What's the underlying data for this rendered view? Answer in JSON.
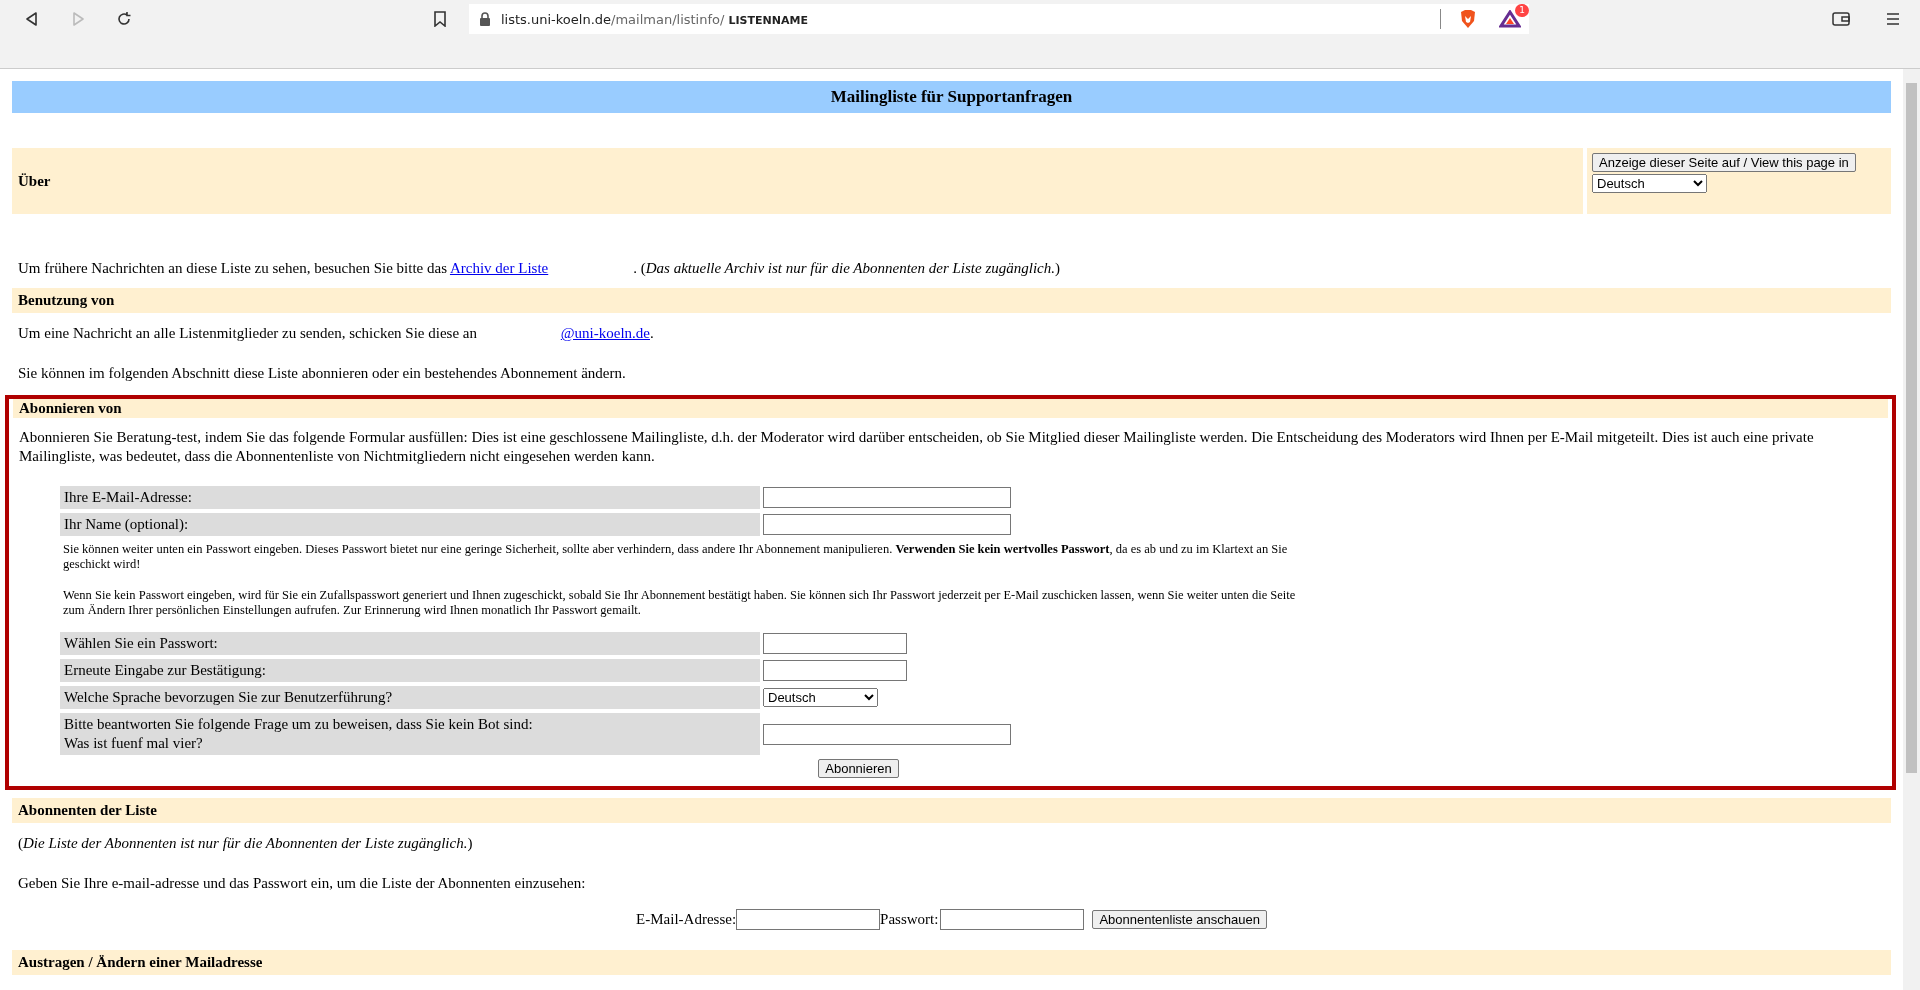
{
  "browser": {
    "url_host": "lists.uni-koeln.de",
    "url_path": "/mailman/listinfo/",
    "url_tail": "LISTENNAME",
    "badge": "1"
  },
  "title": "Mailingliste für Supportanfragen",
  "about": {
    "heading": "Über",
    "lang_button": "Anzeige dieser Seite auf / View this page in",
    "lang_select": "Deutsch"
  },
  "archive": {
    "before": "Um frühere Nachrichten an diese Liste zu sehen, besuchen Sie bitte das",
    "link": "Archiv der Liste",
    "after": ". (*Das aktuelle Archiv ist nur für die Abonnenten der Liste zugänglich.*)"
  },
  "usage": {
    "heading": "Benutzung von",
    "before": "Um eine Nachricht an alle Listenmitglieder zu senden, schicken Sie diese an",
    "link": "@uni-koeln.de",
    "after": ".",
    "note": "Sie können im folgenden Abschnitt diese Liste abonnieren oder ein bestehendes Abonnement ändern."
  },
  "subscribe": {
    "heading": "Abonnieren von",
    "highlighted": true,
    "intro": "Abonnieren Sie Beratung-test, indem Sie das folgende Formular ausfüllen: Dies ist eine geschlossene Mailingliste, d.h. der Moderator wird darüber entscheiden, ob Sie Mitglied dieser Mailingliste werden. Die Entscheidung des Moderators wird Ihnen per E-Mail mitgeteilt. Dies ist auch eine private Mailingliste, was bedeutet, dass die Abonnentenliste von Nichtmitgliedern nicht eingesehen werden kann.",
    "rows": [
      {
        "kind": "field",
        "label": "Ihre E-Mail-Adresse:"
      },
      {
        "kind": "field",
        "label": "Ihr Name (optional):"
      },
      {
        "kind": "note",
        "text": "Sie können weiter unten ein Passwort eingeben. Dieses Passwort bietet nur eine geringe Sicherheit, sollte aber verhindern, dass andere Ihr Abonnement manipulieren. **Verwenden Sie kein wertvolles Passwort**, da es ab und zu im Klartext an Sie geschickt wird!"
      },
      {
        "kind": "note",
        "text": "Wenn Sie kein Passwort eingeben, wird für Sie ein Zufallspasswort generiert und Ihnen zugeschickt, sobald Sie Ihr Abonnement bestätigt haben. Sie können sich Ihr Passwort jederzeit per E-Mail zuschicken lassen, wenn Sie weiter unten die Seite zum Ändern Ihrer persönlichen Einstellungen aufrufen. Zur Erinnerung wird Ihnen monatlich Ihr Passwort gemailt."
      },
      {
        "kind": "password",
        "label": "Wählen Sie ein Passwort:"
      },
      {
        "kind": "password",
        "label": "Erneute Eingabe zur Bestätigung:"
      },
      {
        "kind": "select",
        "label": "Welche Sprache bevorzugen Sie zur Benutzerführung?",
        "value": "Deutsch"
      },
      {
        "kind": "field",
        "label": "Bitte beantworten Sie folgende Frage um zu beweisen, dass Sie kein Bot sind:",
        "label2": "Was ist fuenf mal vier?"
      }
    ],
    "button": "Abonnieren"
  },
  "members": {
    "heading": "Abonnenten der Liste",
    "note": "(*Die Liste der Abonnenten ist nur für die Abonnenten der Liste zugänglich.*)",
    "prompt": "Geben Sie Ihre e-mail-adresse und das Passwort ein, um die Liste der Abonnenten einzusehen:",
    "email_label": "E-Mail-Adresse:",
    "password_label": "Passwort:",
    "button": "Abonnentenliste anschauen"
  },
  "unsubscribe": {
    "heading": "Austragen / Ändern einer Mailadresse"
  }
}
